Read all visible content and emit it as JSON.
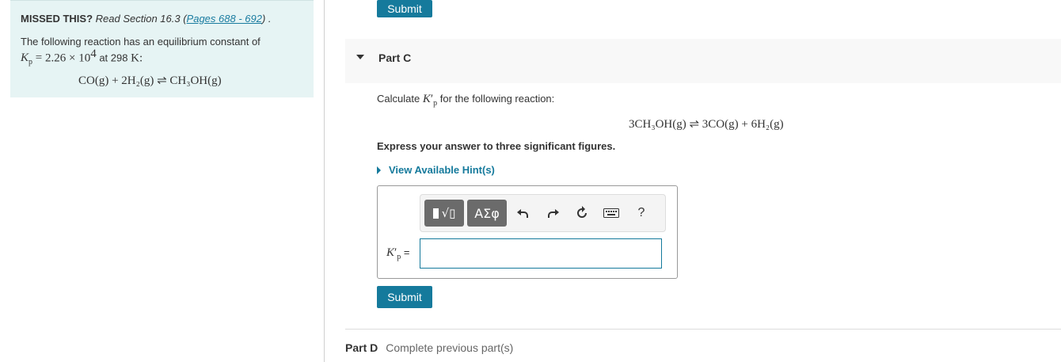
{
  "left_panel": {
    "missed_label": "MISSED THIS?",
    "read_prefix": "Read Section 16.3 (",
    "pages_link": "Pages 688 - 692",
    "read_suffix": ") .",
    "intro": "The following reaction  has an equilibrium constant of",
    "kp_value": "2.26 × 10",
    "kp_exp": "4",
    "at_temp": "at 298",
    "temp_unit": "K:",
    "equation": "CO(g) + 2H₂(g) ⇌ CH₃OH(g)"
  },
  "top_submit_label": "Submit",
  "part_c": {
    "title": "Part C",
    "calc_prefix": "Calculate",
    "calc_suffix": "for the following reaction:",
    "equation": "3CH₃OH(g) ⇌ 3CO(g) + 6H₂(g)",
    "instruction": "Express your answer to three significant figures.",
    "hint_label": "View Available Hint(s)",
    "greek_label": "ΑΣφ",
    "help_label": "?",
    "answer_label_suffix": "=",
    "answer_value": "",
    "submit_label": "Submit"
  },
  "part_d": {
    "title": "Part D",
    "status": "Complete previous part(s)"
  },
  "colors": {
    "accent": "#157a9c",
    "panel_bg": "#e6f4f4",
    "header_bg": "#f8f8f8"
  },
  "icons": [
    "caret-down-icon",
    "caret-right-icon",
    "undo-icon",
    "redo-icon",
    "reset-icon",
    "keyboard-icon",
    "help-icon",
    "template-icon",
    "greek-icon"
  ]
}
